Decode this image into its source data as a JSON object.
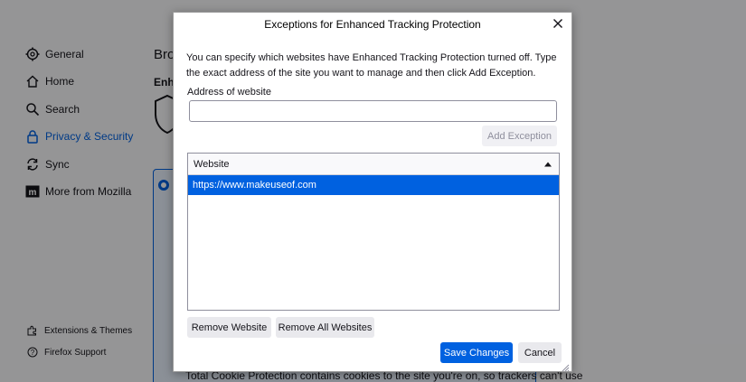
{
  "background": {
    "sidebar": {
      "items": [
        {
          "label": "General",
          "icon": "gear-icon"
        },
        {
          "label": "Home",
          "icon": "home-icon"
        },
        {
          "label": "Search",
          "icon": "search-icon"
        },
        {
          "label": "Privacy & Security",
          "icon": "lock-icon",
          "active": true
        },
        {
          "label": "Sync",
          "icon": "sync-icon"
        },
        {
          "label": "More from Mozilla",
          "icon": "mozilla-icon"
        }
      ],
      "footer": [
        {
          "label": "Extensions & Themes",
          "icon": "puzzle-icon"
        },
        {
          "label": "Firefox Support",
          "icon": "help-icon"
        }
      ]
    },
    "heading_partial": "Bro",
    "subheading_partial": "Enha",
    "card_text": "Total Cookie Protection contains cookies to the site you're on, so trackers can't use"
  },
  "dialog": {
    "title": "Exceptions for Enhanced Tracking Protection",
    "description": "You can specify which websites have Enhanced Tracking Protection turned off. Type the exact address of the site you want to manage and then click Add Exception.",
    "address_label": "Address of website",
    "address_value": "",
    "add_exception_label": "Add Exception",
    "list": {
      "column_header": "Website",
      "rows": [
        "https://www.makeuseof.com"
      ]
    },
    "remove_website_label": "Remove Website",
    "remove_all_label": "Remove All Websites",
    "save_label": "Save Changes",
    "cancel_label": "Cancel"
  },
  "colors": {
    "accent": "#0061e0",
    "overlay": "rgba(0,0,0,0.40)"
  }
}
